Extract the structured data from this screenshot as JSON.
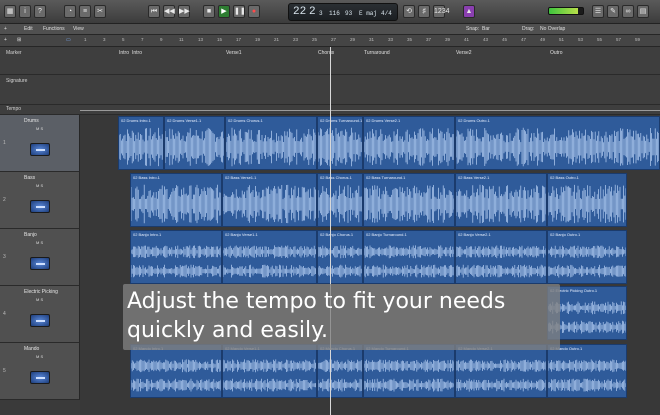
{
  "toolbar": {
    "left_icons": [
      "library-icon",
      "info-icon",
      "help-icon",
      "smart-controls-icon",
      "mixer-icon",
      "editors-icon"
    ],
    "transport": [
      "rewind-to-start",
      "rewind",
      "fast-forward",
      "stop",
      "play",
      "pause",
      "record"
    ],
    "lcd": {
      "bar": "22",
      "beat": "2",
      "sub": "3",
      "tempo": "116",
      "tempo_small": "93",
      "key": "E maj",
      "time_sig": "4/4"
    },
    "right_icons": [
      "list-editors-icon",
      "notepad-icon",
      "loop-browser-icon",
      "browser-icon"
    ],
    "meter_level": 0.85
  },
  "tracks_bar": {
    "menus": [
      "Edit",
      "Functions",
      "View"
    ],
    "snap_label": "Snap:",
    "snap_value": "Bar",
    "drag_label": "Drag:",
    "drag_value": "No Overlap"
  },
  "ruler": [
    "1",
    "3",
    "5",
    "7",
    "9",
    "11",
    "13",
    "15",
    "17",
    "19",
    "21",
    "23",
    "25",
    "27",
    "29",
    "31",
    "33",
    "35",
    "37",
    "39",
    "41",
    "43",
    "45",
    "47",
    "49",
    "51",
    "53",
    "55",
    "57",
    "59"
  ],
  "global_tracks": {
    "marker_label": "Marker",
    "signature_label": "Signature",
    "tempo_label": "Tempo",
    "markers": [
      "Intro",
      "Intro",
      "Verse1",
      "Chorus",
      "Turnaround",
      "Verse2",
      "Outro"
    ]
  },
  "tracks": [
    {
      "num": "1",
      "name": "Drums",
      "ms": "M S",
      "regions": [
        "02 Drums Intro.1",
        "02 Drums Verse1.1",
        "02 Drums Chorus.1",
        "02 Drums Turnaround.1",
        "02 Drums Verse2.1",
        "02 Drums Outro.1"
      ]
    },
    {
      "num": "2",
      "name": "Bass",
      "ms": "M S",
      "regions": [
        "02 Bass Intro.1",
        "02 Bass Verse1.1",
        "02 Bass Chorus.1",
        "02 Bass Turnaround.1",
        "02 Bass Verse2.1",
        "02 Bass Outro.1"
      ]
    },
    {
      "num": "3",
      "name": "Banjo",
      "ms": "M S",
      "regions": [
        "02 Banjo Intro.1",
        "02 Banjo Verse1.1",
        "02 Banjo Chorus.1",
        "02 Banjo Turnaround.1",
        "02 Banjo Verse2.1",
        "02 Banjo Outro.1"
      ]
    },
    {
      "num": "4",
      "name": "Electric Picking",
      "ms": "M S",
      "regions": [
        "02 Electric Picking Outro.1"
      ]
    },
    {
      "num": "5",
      "name": "Mando",
      "ms": "M S",
      "regions": [
        "02 Mando Intro.1",
        "02 Mando Verse1.1",
        "02 Mando Chorus.1",
        "02 Mando Turnaround.1",
        "02 Mando Verse2.1",
        "02 Mando Outro.1"
      ]
    }
  ],
  "caption": "Adjust the tempo to fit your needs quickly and easily.",
  "colors": {
    "region": "#2f5b9a",
    "waveform": "#b9d2f5",
    "play": "#2e7d32",
    "selected_track": "#5b5f66"
  }
}
